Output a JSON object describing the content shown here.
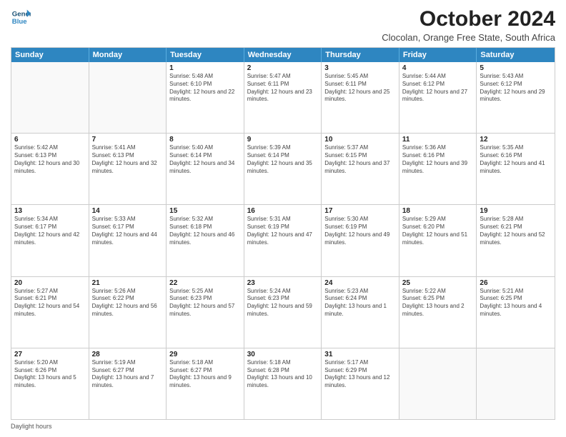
{
  "logo": {
    "line1": "General",
    "line2": "Blue"
  },
  "title": "October 2024",
  "subtitle": "Clocolan, Orange Free State, South Africa",
  "days_of_week": [
    "Sunday",
    "Monday",
    "Tuesday",
    "Wednesday",
    "Thursday",
    "Friday",
    "Saturday"
  ],
  "footer_label": "Daylight hours",
  "weeks": [
    [
      {
        "day": "",
        "sunrise": "",
        "sunset": "",
        "daylight": "",
        "empty": true
      },
      {
        "day": "",
        "sunrise": "",
        "sunset": "",
        "daylight": "",
        "empty": true
      },
      {
        "day": "1",
        "sunrise": "Sunrise: 5:48 AM",
        "sunset": "Sunset: 6:10 PM",
        "daylight": "Daylight: 12 hours and 22 minutes.",
        "empty": false
      },
      {
        "day": "2",
        "sunrise": "Sunrise: 5:47 AM",
        "sunset": "Sunset: 6:11 PM",
        "daylight": "Daylight: 12 hours and 23 minutes.",
        "empty": false
      },
      {
        "day": "3",
        "sunrise": "Sunrise: 5:45 AM",
        "sunset": "Sunset: 6:11 PM",
        "daylight": "Daylight: 12 hours and 25 minutes.",
        "empty": false
      },
      {
        "day": "4",
        "sunrise": "Sunrise: 5:44 AM",
        "sunset": "Sunset: 6:12 PM",
        "daylight": "Daylight: 12 hours and 27 minutes.",
        "empty": false
      },
      {
        "day": "5",
        "sunrise": "Sunrise: 5:43 AM",
        "sunset": "Sunset: 6:12 PM",
        "daylight": "Daylight: 12 hours and 29 minutes.",
        "empty": false
      }
    ],
    [
      {
        "day": "6",
        "sunrise": "Sunrise: 5:42 AM",
        "sunset": "Sunset: 6:13 PM",
        "daylight": "Daylight: 12 hours and 30 minutes.",
        "empty": false
      },
      {
        "day": "7",
        "sunrise": "Sunrise: 5:41 AM",
        "sunset": "Sunset: 6:13 PM",
        "daylight": "Daylight: 12 hours and 32 minutes.",
        "empty": false
      },
      {
        "day": "8",
        "sunrise": "Sunrise: 5:40 AM",
        "sunset": "Sunset: 6:14 PM",
        "daylight": "Daylight: 12 hours and 34 minutes.",
        "empty": false
      },
      {
        "day": "9",
        "sunrise": "Sunrise: 5:39 AM",
        "sunset": "Sunset: 6:14 PM",
        "daylight": "Daylight: 12 hours and 35 minutes.",
        "empty": false
      },
      {
        "day": "10",
        "sunrise": "Sunrise: 5:37 AM",
        "sunset": "Sunset: 6:15 PM",
        "daylight": "Daylight: 12 hours and 37 minutes.",
        "empty": false
      },
      {
        "day": "11",
        "sunrise": "Sunrise: 5:36 AM",
        "sunset": "Sunset: 6:16 PM",
        "daylight": "Daylight: 12 hours and 39 minutes.",
        "empty": false
      },
      {
        "day": "12",
        "sunrise": "Sunrise: 5:35 AM",
        "sunset": "Sunset: 6:16 PM",
        "daylight": "Daylight: 12 hours and 41 minutes.",
        "empty": false
      }
    ],
    [
      {
        "day": "13",
        "sunrise": "Sunrise: 5:34 AM",
        "sunset": "Sunset: 6:17 PM",
        "daylight": "Daylight: 12 hours and 42 minutes.",
        "empty": false
      },
      {
        "day": "14",
        "sunrise": "Sunrise: 5:33 AM",
        "sunset": "Sunset: 6:17 PM",
        "daylight": "Daylight: 12 hours and 44 minutes.",
        "empty": false
      },
      {
        "day": "15",
        "sunrise": "Sunrise: 5:32 AM",
        "sunset": "Sunset: 6:18 PM",
        "daylight": "Daylight: 12 hours and 46 minutes.",
        "empty": false
      },
      {
        "day": "16",
        "sunrise": "Sunrise: 5:31 AM",
        "sunset": "Sunset: 6:19 PM",
        "daylight": "Daylight: 12 hours and 47 minutes.",
        "empty": false
      },
      {
        "day": "17",
        "sunrise": "Sunrise: 5:30 AM",
        "sunset": "Sunset: 6:19 PM",
        "daylight": "Daylight: 12 hours and 49 minutes.",
        "empty": false
      },
      {
        "day": "18",
        "sunrise": "Sunrise: 5:29 AM",
        "sunset": "Sunset: 6:20 PM",
        "daylight": "Daylight: 12 hours and 51 minutes.",
        "empty": false
      },
      {
        "day": "19",
        "sunrise": "Sunrise: 5:28 AM",
        "sunset": "Sunset: 6:21 PM",
        "daylight": "Daylight: 12 hours and 52 minutes.",
        "empty": false
      }
    ],
    [
      {
        "day": "20",
        "sunrise": "Sunrise: 5:27 AM",
        "sunset": "Sunset: 6:21 PM",
        "daylight": "Daylight: 12 hours and 54 minutes.",
        "empty": false
      },
      {
        "day": "21",
        "sunrise": "Sunrise: 5:26 AM",
        "sunset": "Sunset: 6:22 PM",
        "daylight": "Daylight: 12 hours and 56 minutes.",
        "empty": false
      },
      {
        "day": "22",
        "sunrise": "Sunrise: 5:25 AM",
        "sunset": "Sunset: 6:23 PM",
        "daylight": "Daylight: 12 hours and 57 minutes.",
        "empty": false
      },
      {
        "day": "23",
        "sunrise": "Sunrise: 5:24 AM",
        "sunset": "Sunset: 6:23 PM",
        "daylight": "Daylight: 12 hours and 59 minutes.",
        "empty": false
      },
      {
        "day": "24",
        "sunrise": "Sunrise: 5:23 AM",
        "sunset": "Sunset: 6:24 PM",
        "daylight": "Daylight: 13 hours and 1 minute.",
        "empty": false
      },
      {
        "day": "25",
        "sunrise": "Sunrise: 5:22 AM",
        "sunset": "Sunset: 6:25 PM",
        "daylight": "Daylight: 13 hours and 2 minutes.",
        "empty": false
      },
      {
        "day": "26",
        "sunrise": "Sunrise: 5:21 AM",
        "sunset": "Sunset: 6:25 PM",
        "daylight": "Daylight: 13 hours and 4 minutes.",
        "empty": false
      }
    ],
    [
      {
        "day": "27",
        "sunrise": "Sunrise: 5:20 AM",
        "sunset": "Sunset: 6:26 PM",
        "daylight": "Daylight: 13 hours and 5 minutes.",
        "empty": false
      },
      {
        "day": "28",
        "sunrise": "Sunrise: 5:19 AM",
        "sunset": "Sunset: 6:27 PM",
        "daylight": "Daylight: 13 hours and 7 minutes.",
        "empty": false
      },
      {
        "day": "29",
        "sunrise": "Sunrise: 5:18 AM",
        "sunset": "Sunset: 6:27 PM",
        "daylight": "Daylight: 13 hours and 9 minutes.",
        "empty": false
      },
      {
        "day": "30",
        "sunrise": "Sunrise: 5:18 AM",
        "sunset": "Sunset: 6:28 PM",
        "daylight": "Daylight: 13 hours and 10 minutes.",
        "empty": false
      },
      {
        "day": "31",
        "sunrise": "Sunrise: 5:17 AM",
        "sunset": "Sunset: 6:29 PM",
        "daylight": "Daylight: 13 hours and 12 minutes.",
        "empty": false
      },
      {
        "day": "",
        "sunrise": "",
        "sunset": "",
        "daylight": "",
        "empty": true
      },
      {
        "day": "",
        "sunrise": "",
        "sunset": "",
        "daylight": "",
        "empty": true
      }
    ]
  ]
}
